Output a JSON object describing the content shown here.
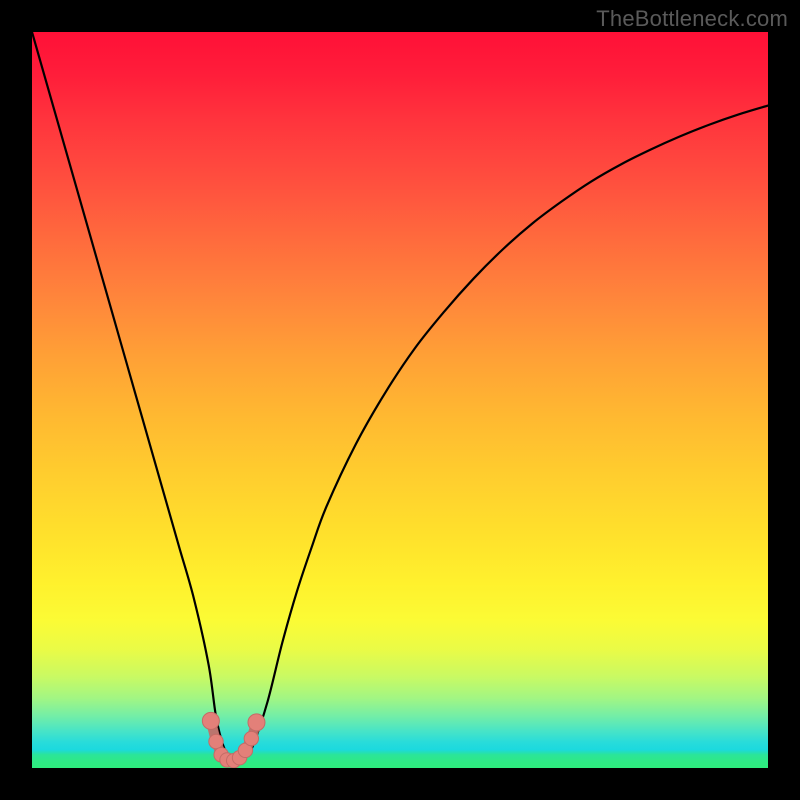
{
  "watermark": "TheBottleneck.com",
  "colors": {
    "frame": "#000000",
    "curve_stroke": "#000000",
    "marker_fill": "#e38079",
    "marker_stroke": "#c46b66"
  },
  "chart_data": {
    "type": "line",
    "title": "",
    "xlabel": "",
    "ylabel": "",
    "xlim": [
      0,
      100
    ],
    "ylim": [
      0,
      100
    ],
    "grid": false,
    "series": [
      {
        "name": "bottleneck-curve",
        "x": [
          0,
          2,
          4,
          6,
          8,
          10,
          12,
          14,
          16,
          18,
          20,
          22,
          24,
          25,
          26,
          27,
          28,
          29,
          30,
          32,
          34,
          36,
          38,
          40,
          44,
          48,
          52,
          56,
          60,
          64,
          68,
          72,
          76,
          80,
          84,
          88,
          92,
          96,
          100
        ],
        "y": [
          100,
          93,
          86,
          79,
          72,
          65,
          58,
          51,
          44,
          37,
          30,
          23,
          14,
          7,
          3,
          1.3,
          1,
          1.4,
          3,
          9,
          17,
          24,
          30,
          35.5,
          44,
          51,
          57,
          62,
          66.5,
          70.5,
          74,
          77,
          79.7,
          82,
          84,
          85.8,
          87.4,
          88.8,
          90
        ]
      }
    ],
    "markers": {
      "name": "highlight-region",
      "x": [
        24.3,
        25.0,
        25.7,
        26.5,
        27.4,
        28.2,
        29.0,
        29.8,
        30.5
      ],
      "y": [
        6.4,
        3.6,
        1.8,
        1.1,
        1.0,
        1.4,
        2.4,
        4.0,
        6.2
      ]
    },
    "gradient_stops": [
      {
        "pos": 0.0,
        "color": "#ff1037"
      },
      {
        "pos": 0.2,
        "color": "#ff4e3e"
      },
      {
        "pos": 0.44,
        "color": "#ffa036"
      },
      {
        "pos": 0.68,
        "color": "#ffe02c"
      },
      {
        "pos": 0.85,
        "color": "#d7fa58"
      },
      {
        "pos": 0.95,
        "color": "#47e4c7"
      },
      {
        "pos": 1.0,
        "color": "#2eec7d"
      }
    ]
  }
}
